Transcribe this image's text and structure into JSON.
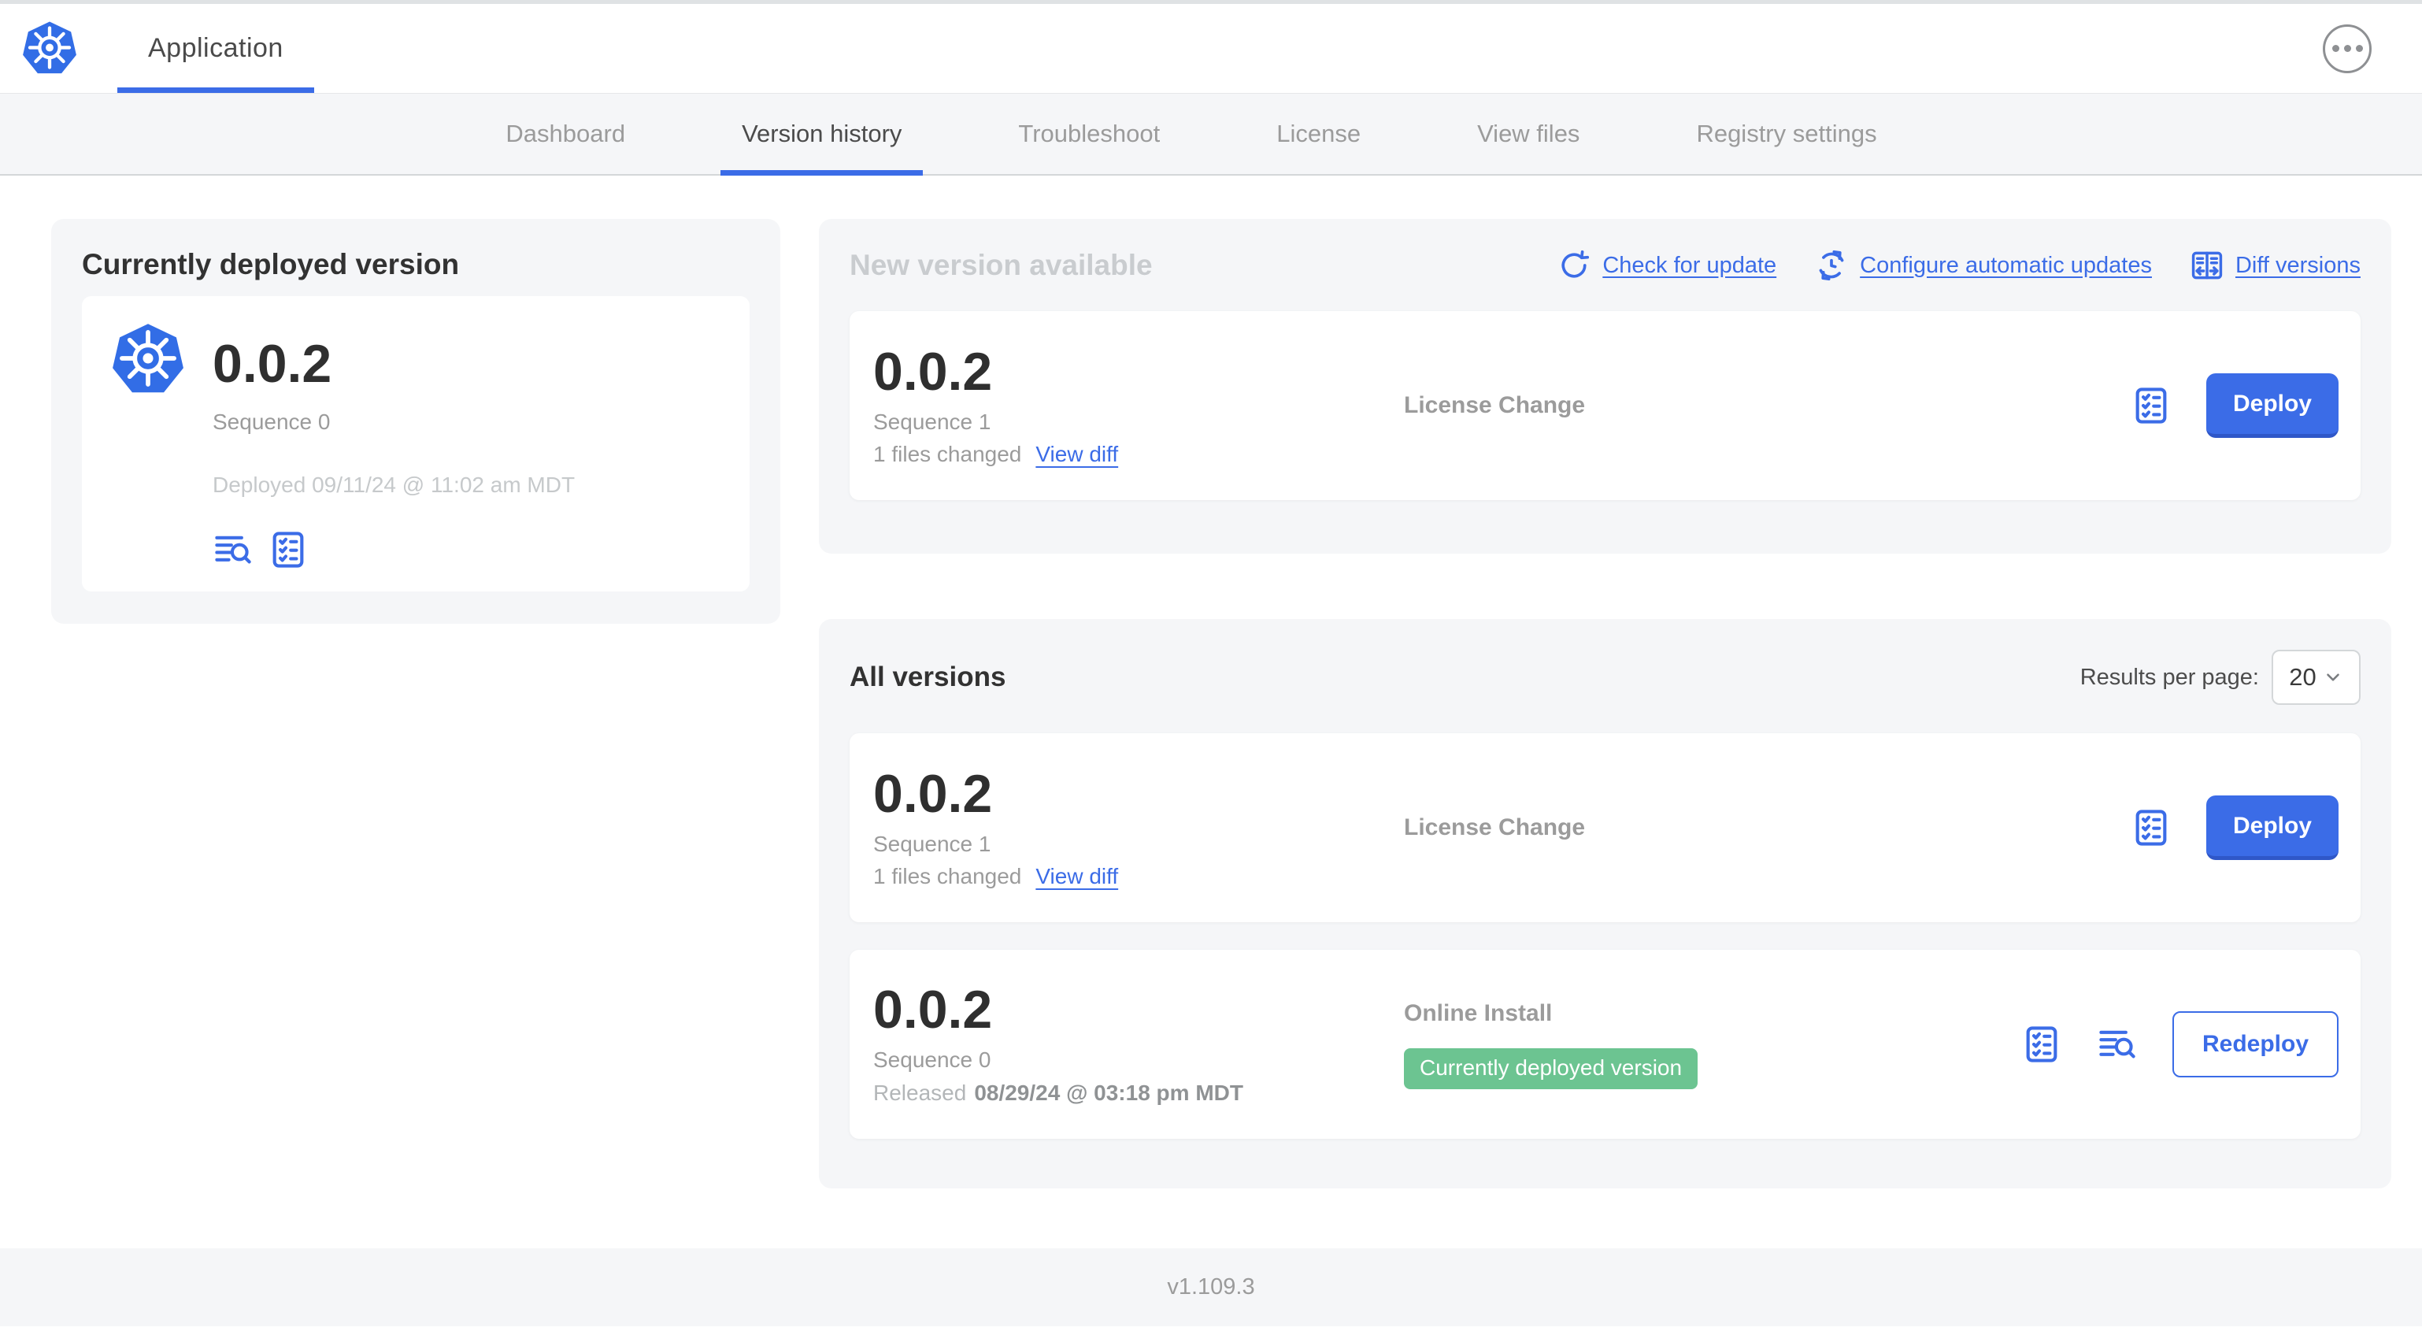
{
  "colors": {
    "accent": "#3b6ce7",
    "logo_blue": "#326de6",
    "badge_green": "#6cc491",
    "panel_bg": "#f5f6f8"
  },
  "header": {
    "app_title": "Application"
  },
  "nav": {
    "tabs": [
      {
        "label": "Dashboard",
        "active": false
      },
      {
        "label": "Version history",
        "active": true
      },
      {
        "label": "Troubleshoot",
        "active": false
      },
      {
        "label": "License",
        "active": false
      },
      {
        "label": "View files",
        "active": false
      },
      {
        "label": "Registry settings",
        "active": false
      }
    ]
  },
  "current_version": {
    "title": "Currently deployed version",
    "version": "0.0.2",
    "sequence": "Sequence 0",
    "deployed": "Deployed 09/11/24 @ 11:02 am MDT"
  },
  "new_version": {
    "title": "New version available",
    "actions": {
      "check": "Check for update",
      "configure": "Configure automatic updates",
      "diff": "Diff versions"
    },
    "card": {
      "version": "0.0.2",
      "sequence": "Sequence 1",
      "files_changed": "1 files changed",
      "view_diff": "View diff",
      "source": "License Change",
      "action": "Deploy"
    }
  },
  "all_versions": {
    "title": "All versions",
    "per_page_label": "Results per page:",
    "per_page_value": "20",
    "rows": [
      {
        "version": "0.0.2",
        "sequence": "Sequence 1",
        "files_changed": "1 files changed",
        "view_diff": "View diff",
        "source": "License Change",
        "action": "Deploy"
      },
      {
        "version": "0.0.2",
        "sequence": "Sequence 0",
        "released_prefix": "Released",
        "released_date": "08/29/24 @ 03:18 pm MDT",
        "source": "Online Install",
        "badge": "Currently deployed version",
        "action": "Redeploy"
      }
    ]
  },
  "footer": {
    "version": "v1.109.3"
  }
}
